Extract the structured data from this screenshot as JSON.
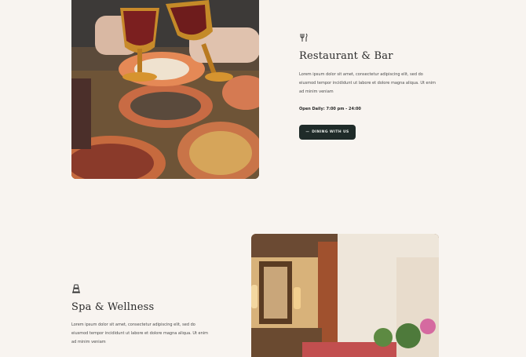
{
  "restaurant": {
    "icon": "utensils-icon",
    "title": "Restaurant & Bar",
    "description": "Lorem ipsum dolor sit amet, consectetur adipiscing elit, sed do eiusmod tempor incididunt ut labore et dolore magna aliqua. Ut enim ad minim veniam",
    "hours": "Open Daily: 7:00 pm - 24:00",
    "button_label": "DINING WITH US",
    "button_arrow": "—"
  },
  "spa": {
    "icon": "spa-lamp-icon",
    "title": "Spa & Wellness",
    "description": "Lorem ipsum dolor sit amet, consectetur adipiscing elit, sed do eiusmod tempor incididunt ut labore et dolore magna aliqua. Ut enim ad minim veniam"
  },
  "colors": {
    "background": "#f8f4f0",
    "button": "#1f2b29"
  }
}
